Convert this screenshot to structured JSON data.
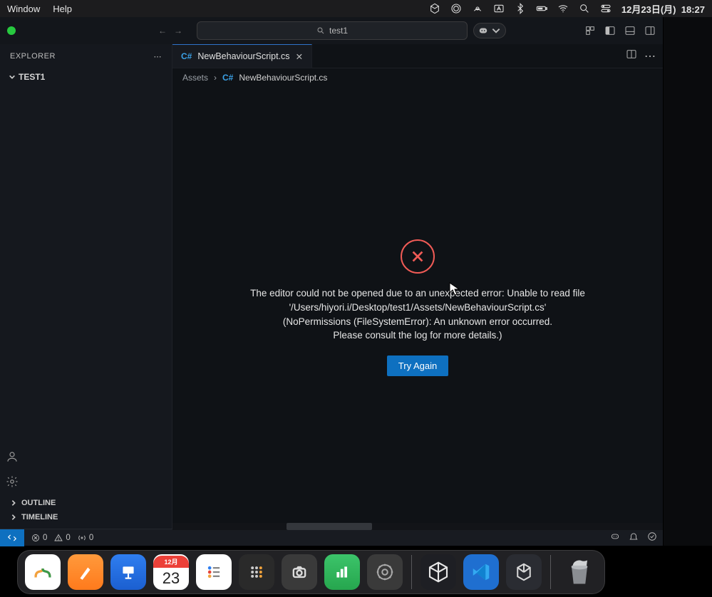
{
  "menubar": {
    "items": [
      "Window",
      "Help"
    ],
    "date": "12月23日(月)",
    "time": "18:27"
  },
  "commandCenter": {
    "text": "test1"
  },
  "sidebar": {
    "title": "EXPLORER",
    "root": "TEST1",
    "sections": {
      "outline": "OUTLINE",
      "timeline": "TIMELINE"
    }
  },
  "tab": {
    "filename": "NewBehaviourScript.cs",
    "breadcrumbRoot": "Assets",
    "breadcrumbSep": "›"
  },
  "error": {
    "line1": "The editor could not be opened due to an unexpected error: Unable to read file",
    "line2": "'/Users/hiyori.i/Desktop/test1/Assets/NewBehaviourScript.cs'",
    "line3": "(NoPermissions (FileSystemError): An unknown error occurred.",
    "line4": "Please consult the log for more details.)",
    "button": "Try Again"
  },
  "status": {
    "errors": "0",
    "warnings": "0",
    "ports": "0"
  },
  "dock": {
    "calendarMonth": "12月",
    "calendarDay": "23"
  }
}
